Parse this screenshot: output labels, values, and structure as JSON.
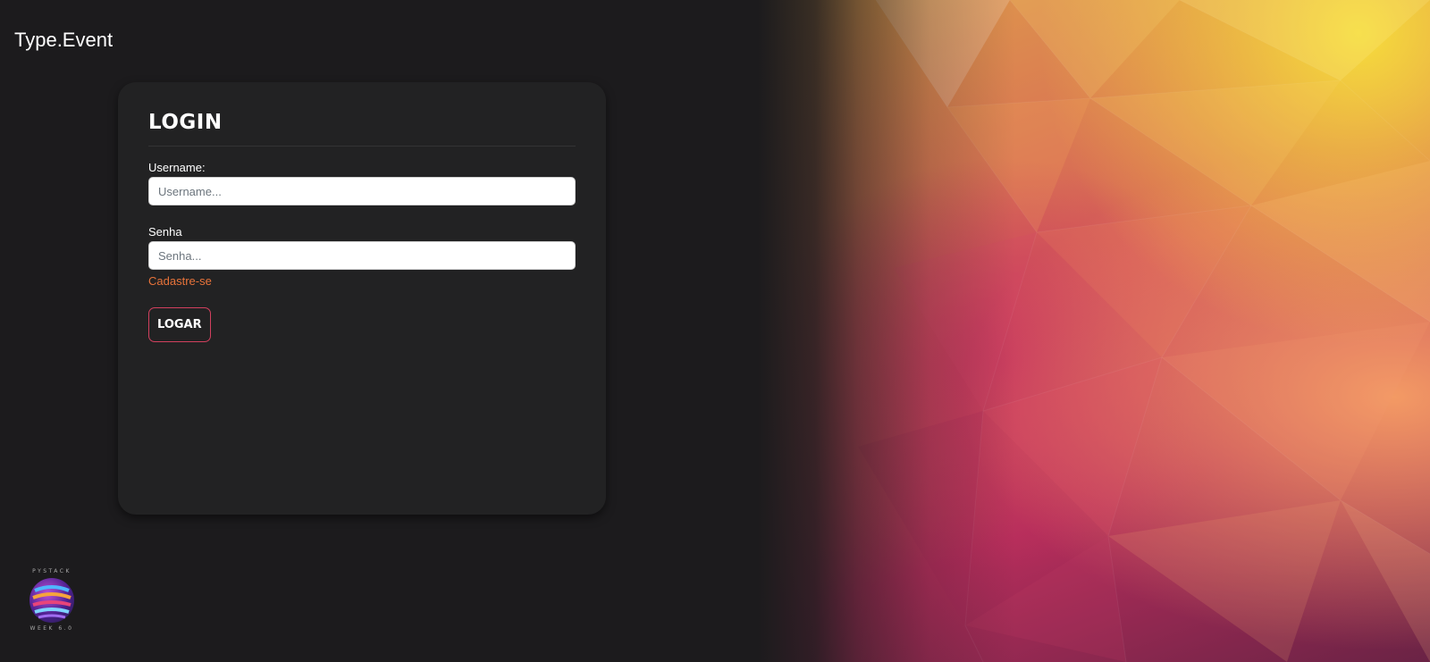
{
  "brand": {
    "title": "Type.Event"
  },
  "login": {
    "title": "LOGIN",
    "username_label": "Username:",
    "username_placeholder": "Username...",
    "username_value": "",
    "password_label": "Senha",
    "password_placeholder": "Senha...",
    "password_value": "",
    "register_link": "Cadastre-se",
    "submit_label": "LOGAR"
  },
  "logo": {
    "top_text": "PYSTACK",
    "bottom_text": "WEEK 6.0",
    "icon": "pystack-week-logo"
  },
  "colors": {
    "background": "#1c1b1d",
    "card": "#222223",
    "link": "#e8733a",
    "button_border": "#d2405e"
  }
}
